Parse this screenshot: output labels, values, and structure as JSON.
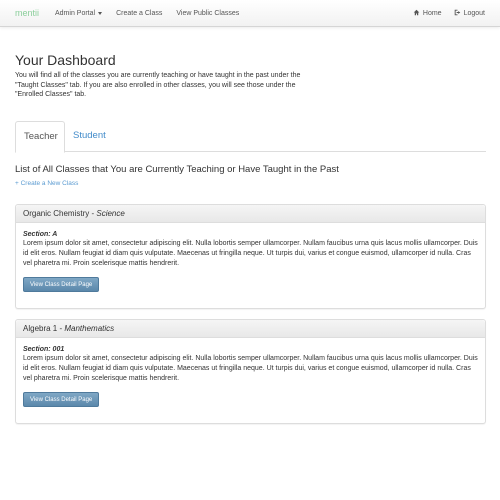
{
  "navbar": {
    "brand": "mentii",
    "links": [
      {
        "label": "Admin Portal",
        "dropdown": true
      },
      {
        "label": "Create a Class"
      },
      {
        "label": "View Public Classes"
      }
    ],
    "right_links": [
      {
        "label": "Home",
        "icon": "home-icon"
      },
      {
        "label": "Logout",
        "icon": "logout-icon"
      }
    ]
  },
  "dashboard": {
    "title": "Your Dashboard",
    "intro": "You will find all of the classes you are currently teaching or have taught in the past under the \"Taught Classes\" tab. If you are also enrolled in other classes, you will see those under the \"Enrolled Classes\" tab."
  },
  "tabs": [
    {
      "label": "Teacher",
      "active": true
    },
    {
      "label": "Student",
      "active": false
    }
  ],
  "class_list": {
    "title": "List of All Classes that You are Currently Teaching or Have Taught in the Past",
    "create_link": "Create a New Class",
    "classes": [
      {
        "name": "Organic Chemistry",
        "subject": "Science",
        "section": "Section: A",
        "description": "Lorem ipsum dolor sit amet, consectetur adipiscing elit. Nulla lobortis semper ullamcorper. Nullam faucibus urna quis lacus mollis ullamcorper. Duis id elit eros. Nullam feugiat id diam quis vulputate. Maecenas ut fringilla neque. Ut turpis dui, varius et congue euismod, ullamcorper id nulla. Cras vel pharetra mi. Proin scelerisque mattis hendrerit.",
        "button": "View Class Detail Page"
      },
      {
        "name": "Algebra 1",
        "subject": "Manthematics",
        "section": "Section: 001",
        "description": "Lorem ipsum dolor sit amet, consectetur adipiscing elit. Nulla lobortis semper ullamcorper. Nullam faucibus urna quis lacus mollis ullamcorper. Duis id elit eros. Nullam feugiat id diam quis vulputate. Maecenas ut fringilla neque. Ut turpis dui, varius et congue euismod, ullamcorper id nulla. Cras vel pharetra mi. Proin scelerisque mattis hendrerit.",
        "button": "View Class Detail Page"
      }
    ]
  },
  "colors": {
    "brand": "#8ccf9c",
    "link": "#428bca",
    "button": "#6a95b8"
  }
}
